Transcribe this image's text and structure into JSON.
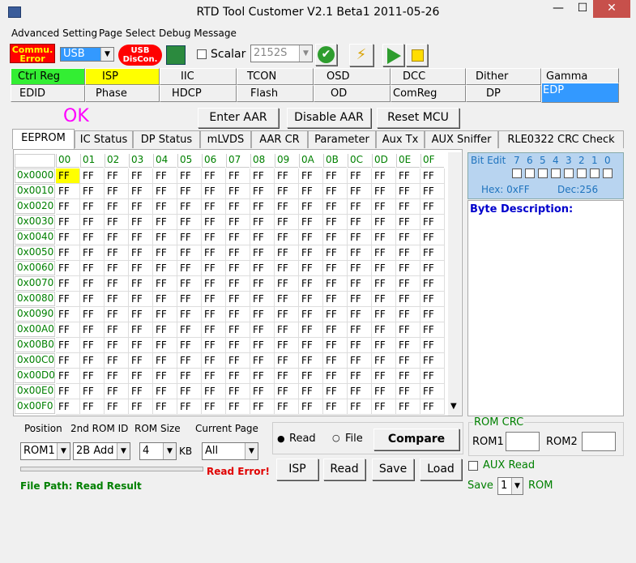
{
  "window": {
    "title": "RTD Tool Customer V2.1 Beta1    2011-05-26",
    "minimize": "—",
    "maximize": "☐",
    "close": "✕"
  },
  "menu": [
    "Advanced Setting",
    "Page Select",
    "Debug Message"
  ],
  "toolbar": {
    "comm_error": "Commu.\nError",
    "usb_select": "USB",
    "usb_disconnect": "USB\nDisCon.",
    "scalar_label": "Scalar",
    "scalar_value": "2152S"
  },
  "tabs_row1": [
    "Ctrl Reg",
    "ISP",
    "IIC",
    "TCON",
    "OSD",
    "DCC",
    "Dither",
    "Gamma"
  ],
  "tabs_row2": [
    "EDID",
    "Phase",
    "HDCP",
    "Flash",
    "OD",
    "ComReg",
    "DP",
    "EDP"
  ],
  "status_ok": "OK",
  "aar_buttons": [
    "Enter AAR",
    "Disable AAR",
    "Reset MCU"
  ],
  "subtabs": [
    "EEPROM",
    "IC Status",
    "DP Status",
    "mLVDS",
    "AAR CR",
    "Parameter",
    "Aux Tx",
    "AUX Sniffer",
    "RLE0322 CRC Check"
  ],
  "grid": {
    "columns": [
      "00",
      "01",
      "02",
      "03",
      "04",
      "05",
      "06",
      "07",
      "08",
      "09",
      "0A",
      "0B",
      "0C",
      "0D",
      "0E",
      "0F"
    ],
    "rows": [
      "0x0000",
      "0x0010",
      "0x0020",
      "0x0030",
      "0x0040",
      "0x0050",
      "0x0060",
      "0x0070",
      "0x0080",
      "0x0090",
      "0x00A0",
      "0x00B0",
      "0x00C0",
      "0x00D0",
      "0x00E0",
      "0x00F0"
    ],
    "value": "FF"
  },
  "bit_edit": {
    "label": "Bit Edit",
    "bits": [
      "7",
      "6",
      "5",
      "4",
      "3",
      "2",
      "1",
      "0"
    ],
    "hex": "Hex: 0xFF",
    "dec": "Dec:256"
  },
  "byte_description_label": "Byte Description:",
  "bottom": {
    "position_label": "Position",
    "rom_id_label": "2nd ROM ID",
    "rom_size_label": "ROM Size",
    "current_page_label": "Current Page",
    "position_value": "ROM1",
    "rom_id_value": "2B Add",
    "rom_size_value": "4",
    "kb_label": "KB",
    "current_page_value": "All",
    "read_error": "Read Error!",
    "file_path": "File Path: Read Result"
  },
  "io": {
    "read_radio": "Read",
    "file_radio": "File",
    "compare": "Compare",
    "isp": "ISP",
    "read": "Read",
    "save": "Save",
    "load": "Load"
  },
  "rom_crc": {
    "label": "ROM CRC",
    "rom1": "ROM1",
    "rom2": "ROM2"
  },
  "aux": {
    "aux_read": "AUX Read",
    "save_label": "Save",
    "save_value": "1",
    "rom_label": "ROM"
  }
}
